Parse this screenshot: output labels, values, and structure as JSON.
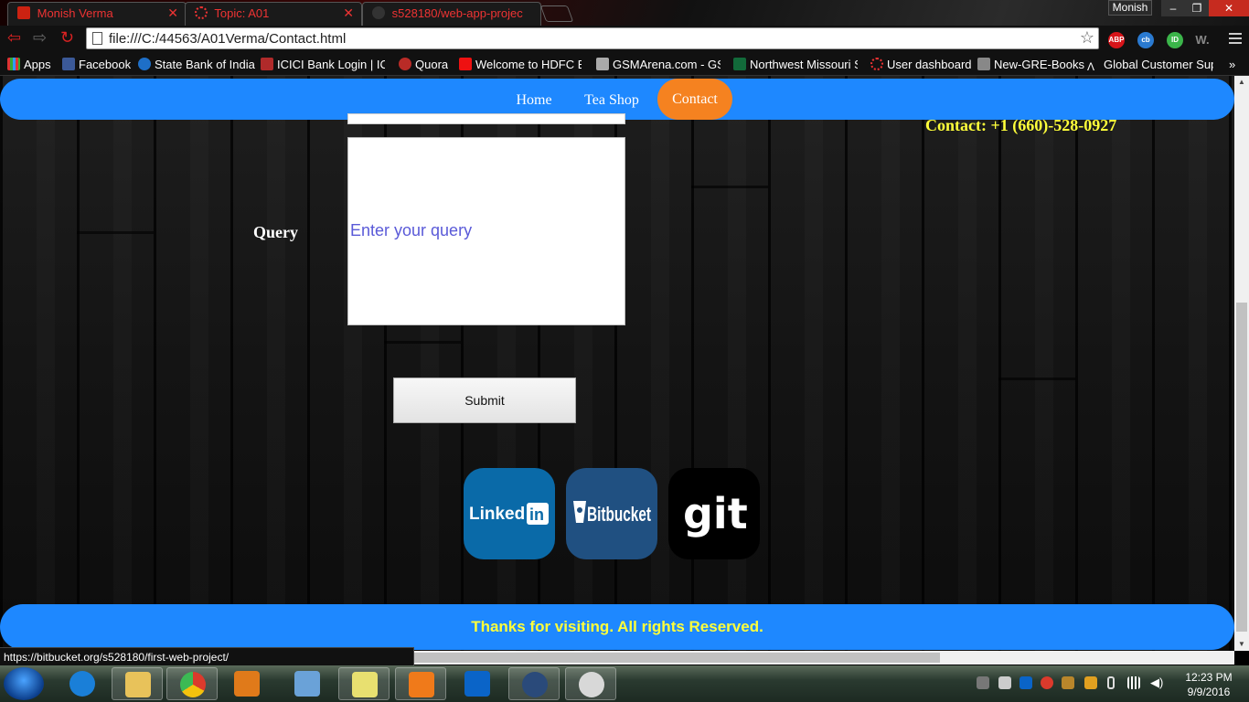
{
  "browser": {
    "tabs": [
      {
        "title": "Monish Verma",
        "favicon": "red-page-icon"
      },
      {
        "title": "Topic: A01",
        "favicon": "loading-ring-icon"
      },
      {
        "title": "s528180/web-app-projec",
        "favicon": "github-icon"
      }
    ],
    "profile_name": "Monish",
    "window_controls": {
      "minimize": "–",
      "maximize": "❐",
      "close": "✕"
    },
    "address": "file:///C:/44563/A01Verma/Contact.html",
    "extensions": [
      {
        "name": "adblock-plus-icon",
        "label": "ABP",
        "color": "#d7141a"
      },
      {
        "name": "cashback-icon",
        "label": "cb",
        "color": "#2a7ad1"
      },
      {
        "name": "ip-icon",
        "label": "ID",
        "color": "#3bb54a"
      },
      {
        "name": "word-icon",
        "label": "W.",
        "color": "#666666"
      }
    ],
    "bookmarks": [
      {
        "label": "Apps",
        "icon": "apps-grid-icon"
      },
      {
        "label": "Facebook",
        "icon": "facebook-icon"
      },
      {
        "label": "State Bank of India",
        "icon": "sbi-icon"
      },
      {
        "label": "ICICI Bank Login | ICIC",
        "icon": "icici-icon"
      },
      {
        "label": "Quora",
        "icon": "quora-icon"
      },
      {
        "label": "Welcome to HDFC Ba",
        "icon": "hdfc-icon"
      },
      {
        "label": "GSMArena.com - GSM",
        "icon": "gsmarena-icon"
      },
      {
        "label": "Northwest Missouri St",
        "icon": "northwest-icon"
      },
      {
        "label": "User dashboard",
        "icon": "dashboard-icon"
      },
      {
        "label": "New-GRE-Books",
        "icon": "books-icon"
      },
      {
        "label": "Global Customer Supp",
        "icon": "support-icon"
      }
    ],
    "status_url": "https://bitbucket.org/s528180/first-web-project/"
  },
  "page": {
    "nav": {
      "items": [
        {
          "label": "Home",
          "active": false
        },
        {
          "label": "Tea Shop",
          "active": false
        },
        {
          "label": "Contact",
          "active": true
        }
      ]
    },
    "contact_info": "Contact: +1 (660)-528-0927",
    "form": {
      "query_label": "Query",
      "query_placeholder": "Enter your query",
      "submit_label": "Submit"
    },
    "social": [
      {
        "name": "linkedin",
        "text": "Linked",
        "badge": "in",
        "color": "#0a6aa8"
      },
      {
        "name": "bitbucket",
        "text": "Bitbucket",
        "color": "#205081"
      },
      {
        "name": "git",
        "text": "git",
        "color": "#000000"
      }
    ],
    "footer_text": "Thanks for visiting. All rights Reserved.",
    "colors": {
      "bar_blue": "#1e88ff",
      "active_orange": "#f58220",
      "highlight_yellow": "#ffff3a"
    }
  },
  "taskbar": {
    "apps": [
      {
        "name": "internet-explorer-icon",
        "color": "#1a7fd8"
      },
      {
        "name": "file-explorer-icon",
        "color": "#e8c25a"
      },
      {
        "name": "chrome-icon",
        "color": "#db3a2c"
      },
      {
        "name": "media-player-icon",
        "color": "#e07a1a"
      },
      {
        "name": "virtualbox-icon",
        "color": "#6aa2d8"
      },
      {
        "name": "sticky-notes-icon",
        "color": "#e8e070"
      },
      {
        "name": "sublime-text-icon",
        "color": "#f07a1a"
      },
      {
        "name": "outlook-icon",
        "color": "#0a64c8"
      },
      {
        "name": "sourcetree-icon",
        "color": "#2a4a7a"
      },
      {
        "name": "paint-icon",
        "color": "#d8d8d8"
      }
    ],
    "clock_time": "12:23 PM",
    "clock_date": "9/9/2016"
  }
}
